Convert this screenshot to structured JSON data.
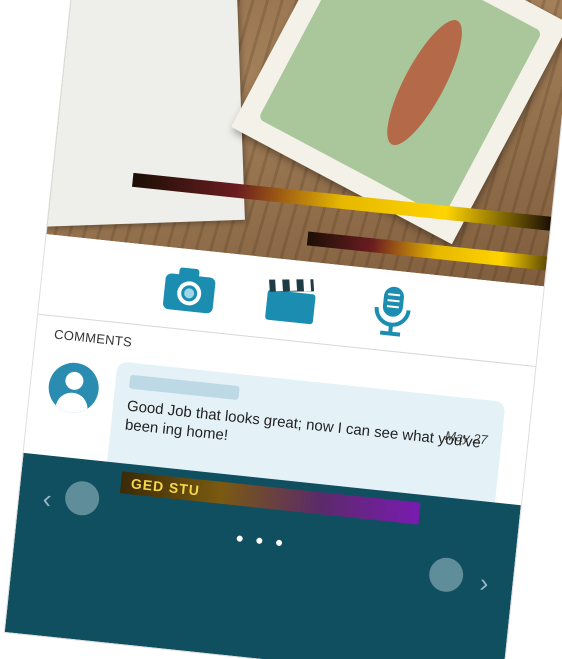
{
  "comments": {
    "title": "COMMENTS",
    "items": [
      {
        "text": "Good Job        that looks great; now I can see what you've been    ing   home!",
        "date": "May 27"
      }
    ]
  },
  "media": {
    "icons": [
      "camera-icon",
      "video-clapperboard-icon",
      "microphone-icon"
    ]
  },
  "bottom_bar": {
    "label": "GED STU",
    "more": "• • •"
  },
  "colors": {
    "accent": "#1a8db0",
    "bubble": "#e4f2f8",
    "bottom_bar": "#0f4f60"
  }
}
